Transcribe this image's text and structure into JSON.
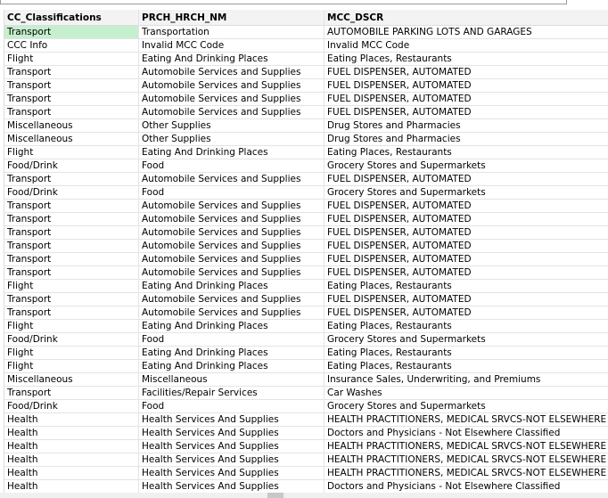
{
  "columns": [
    "CC_Classifications",
    "PRCH_HRCH_NM",
    "MCC_DSCR"
  ],
  "rows": [
    [
      "Transport",
      "Transportation",
      "AUTOMOBILE PARKING LOTS AND GARAGES"
    ],
    [
      "CCC Info",
      "Invalid MCC Code",
      "Invalid MCC Code"
    ],
    [
      "Flight",
      "Eating And Drinking Places",
      "Eating Places, Restaurants"
    ],
    [
      "Transport",
      "Automobile Services and Supplies",
      "FUEL DISPENSER, AUTOMATED"
    ],
    [
      "Transport",
      "Automobile Services and Supplies",
      "FUEL DISPENSER, AUTOMATED"
    ],
    [
      "Transport",
      "Automobile Services and Supplies",
      "FUEL DISPENSER, AUTOMATED"
    ],
    [
      "Transport",
      "Automobile Services and Supplies",
      "FUEL DISPENSER, AUTOMATED"
    ],
    [
      "Miscellaneous",
      "Other Supplies",
      "Drug Stores and Pharmacies"
    ],
    [
      "Miscellaneous",
      "Other Supplies",
      "Drug Stores and Pharmacies"
    ],
    [
      "Flight",
      "Eating And Drinking Places",
      "Eating Places, Restaurants"
    ],
    [
      "Food/Drink",
      "Food",
      "Grocery Stores and Supermarkets"
    ],
    [
      "Transport",
      "Automobile Services and Supplies",
      "FUEL DISPENSER, AUTOMATED"
    ],
    [
      "Food/Drink",
      "Food",
      "Grocery Stores and Supermarkets"
    ],
    [
      "Transport",
      "Automobile Services and Supplies",
      "FUEL DISPENSER, AUTOMATED"
    ],
    [
      "Transport",
      "Automobile Services and Supplies",
      "FUEL DISPENSER, AUTOMATED"
    ],
    [
      "Transport",
      "Automobile Services and Supplies",
      "FUEL DISPENSER, AUTOMATED"
    ],
    [
      "Transport",
      "Automobile Services and Supplies",
      "FUEL DISPENSER, AUTOMATED"
    ],
    [
      "Transport",
      "Automobile Services and Supplies",
      "FUEL DISPENSER, AUTOMATED"
    ],
    [
      "Transport",
      "Automobile Services and Supplies",
      "FUEL DISPENSER, AUTOMATED"
    ],
    [
      "Flight",
      "Eating And Drinking Places",
      "Eating Places, Restaurants"
    ],
    [
      "Transport",
      "Automobile Services and Supplies",
      "FUEL DISPENSER, AUTOMATED"
    ],
    [
      "Transport",
      "Automobile Services and Supplies",
      "FUEL DISPENSER, AUTOMATED"
    ],
    [
      "Flight",
      "Eating And Drinking Places",
      "Eating Places, Restaurants"
    ],
    [
      "Food/Drink",
      "Food",
      "Grocery Stores and Supermarkets"
    ],
    [
      "Flight",
      "Eating And Drinking Places",
      "Eating Places, Restaurants"
    ],
    [
      "Flight",
      "Eating And Drinking Places",
      "Eating Places, Restaurants"
    ],
    [
      "Miscellaneous",
      "Miscellaneous",
      "Insurance Sales, Underwriting, and Premiums"
    ],
    [
      "Transport",
      "Facilities/Repair Services",
      "Car Washes"
    ],
    [
      "Food/Drink",
      "Food",
      "Grocery Stores and Supermarkets"
    ],
    [
      "Health",
      "Health Services And Supplies",
      "HEALTH PRACTITIONERS, MEDICAL SRVCS-NOT ELSEWHERE"
    ],
    [
      "Health",
      "Health Services And Supplies",
      "Doctors and Physicians - Not Elsewhere Classified"
    ],
    [
      "Health",
      "Health Services And Supplies",
      "HEALTH PRACTITIONERS, MEDICAL SRVCS-NOT ELSEWHERE"
    ],
    [
      "Health",
      "Health Services And Supplies",
      "HEALTH PRACTITIONERS, MEDICAL SRVCS-NOT ELSEWHERE"
    ],
    [
      "Health",
      "Health Services And Supplies",
      "HEALTH PRACTITIONERS, MEDICAL SRVCS-NOT ELSEWHERE"
    ],
    [
      "Health",
      "Health Services And Supplies",
      "Doctors and Physicians - Not Elsewhere Classified"
    ]
  ],
  "colors": {
    "selected_cell": "#c6efce"
  }
}
